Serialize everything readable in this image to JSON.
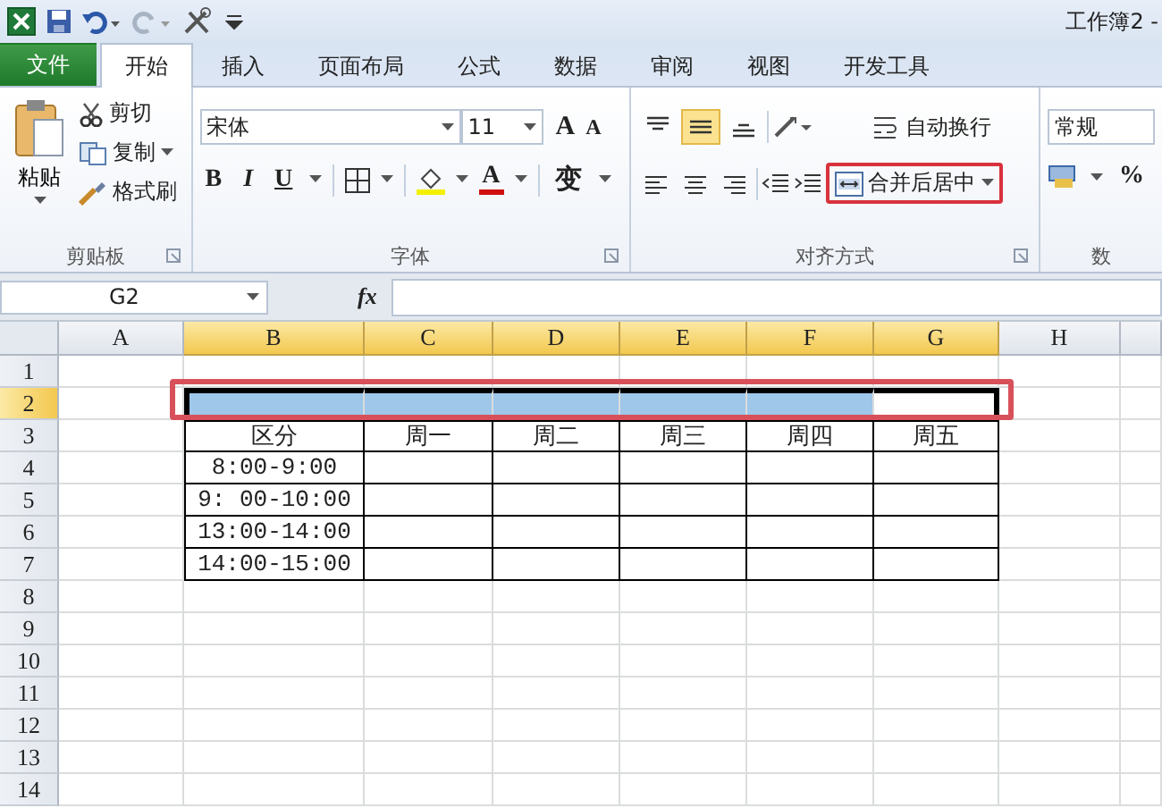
{
  "title_bar": {
    "document_title": "工作簿2 -"
  },
  "tabs": [
    {
      "label": "文件",
      "kind": "file",
      "selected": false
    },
    {
      "label": "开始",
      "kind": "tab",
      "selected": true
    },
    {
      "label": "插入",
      "kind": "tab",
      "selected": false
    },
    {
      "label": "页面布局",
      "kind": "tab",
      "selected": false
    },
    {
      "label": "公式",
      "kind": "tab",
      "selected": false
    },
    {
      "label": "数据",
      "kind": "tab",
      "selected": false
    },
    {
      "label": "审阅",
      "kind": "tab",
      "selected": false
    },
    {
      "label": "视图",
      "kind": "tab",
      "selected": false
    },
    {
      "label": "开发工具",
      "kind": "tab",
      "selected": false
    }
  ],
  "ribbon": {
    "clipboard": {
      "paste": "粘贴",
      "cut": "剪切",
      "copy": "复制",
      "format_painter": "格式刷",
      "label": "剪贴板"
    },
    "font": {
      "font_name": "宋体",
      "font_size": "11",
      "grow": "A",
      "shrink": "A",
      "bold": "B",
      "italic": "I",
      "underline": "U",
      "font_color": "A",
      "phonetic": "变",
      "label": "字体"
    },
    "alignment": {
      "vertical": [
        {
          "kind": "top",
          "selected": false
        },
        {
          "kind": "middle",
          "selected": true
        },
        {
          "kind": "bottom",
          "selected": false
        }
      ],
      "wrap_text": "自动换行",
      "merge_center": {
        "label": "合并后居中",
        "annotated": true
      },
      "label": "对齐方式"
    },
    "number": {
      "format": "常规",
      "percent": "%",
      "label": "数"
    }
  },
  "formula_bar": {
    "name_box": "G2",
    "fx": "fx"
  },
  "sheet": {
    "columns": [
      {
        "label": "A",
        "selected": false
      },
      {
        "label": "B",
        "selected": true,
        "active": false
      },
      {
        "label": "C",
        "selected": true,
        "active": false
      },
      {
        "label": "D",
        "selected": true,
        "active": false
      },
      {
        "label": "E",
        "selected": true,
        "active": false
      },
      {
        "label": "F",
        "selected": true,
        "active": false
      },
      {
        "label": "G",
        "selected": true,
        "active": true
      },
      {
        "label": "H",
        "selected": false
      }
    ],
    "rows": [
      {
        "label": "1",
        "selected": false,
        "annotated": false
      },
      {
        "label": "2",
        "selected": true,
        "annotated": true
      },
      {
        "label": "3",
        "selected": false,
        "annotated": false
      },
      {
        "label": "4",
        "selected": false,
        "annotated": false
      },
      {
        "label": "5",
        "selected": false,
        "annotated": false
      },
      {
        "label": "6",
        "selected": false,
        "annotated": false
      },
      {
        "label": "7",
        "selected": false,
        "annotated": false
      },
      {
        "label": "8",
        "selected": false,
        "annotated": false
      },
      {
        "label": "9",
        "selected": false,
        "annotated": false
      },
      {
        "label": "10",
        "selected": false,
        "annotated": false
      },
      {
        "label": "11",
        "selected": false,
        "annotated": false
      },
      {
        "label": "12",
        "selected": false,
        "annotated": false
      },
      {
        "label": "13",
        "selected": false,
        "annotated": false
      },
      {
        "label": "14",
        "selected": false,
        "annotated": false
      }
    ],
    "table": {
      "header": [
        "区分",
        "周一",
        "周二",
        "周三",
        "周四",
        "周五"
      ],
      "row_labels": [
        "8:00-9:00",
        "9: 00-10:00",
        "13:00-14:00",
        "14:00-15:00"
      ]
    }
  }
}
